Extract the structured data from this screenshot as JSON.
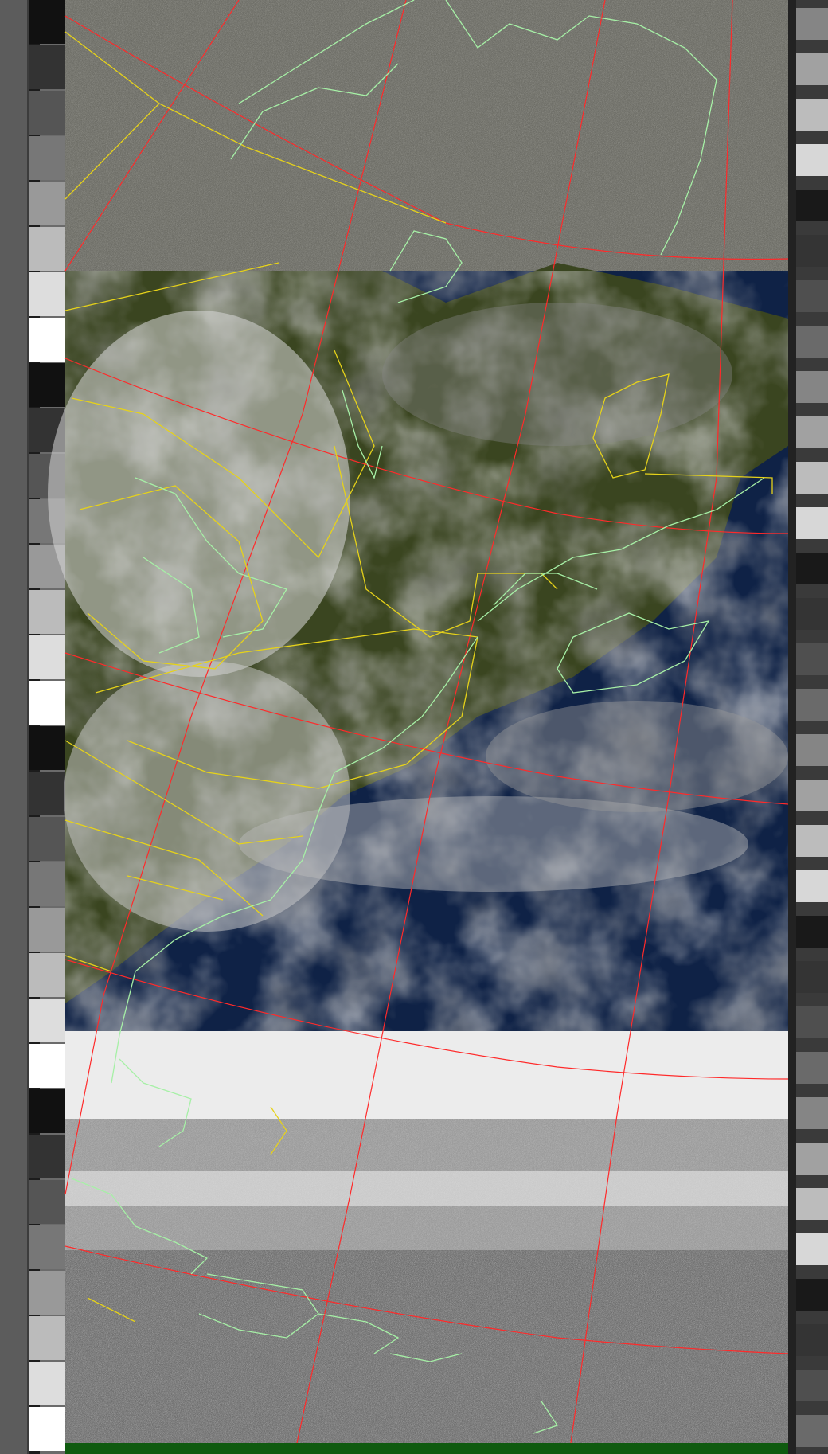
{
  "image": {
    "kind": "satellite-weather-image",
    "description_text": "",
    "colors": {
      "noise_dark": "#3a3a3a",
      "noise_light": "#cfcfcf",
      "land": "#3b4620",
      "ocean": "#0f2246",
      "cloud": "#d9d9d9",
      "clear_band": "#ececec",
      "graticule": "#ff2a2a",
      "borders": "#e6d21a",
      "coastline": "#a6f0a6",
      "bottom_strip": "#0f5a0f"
    }
  }
}
